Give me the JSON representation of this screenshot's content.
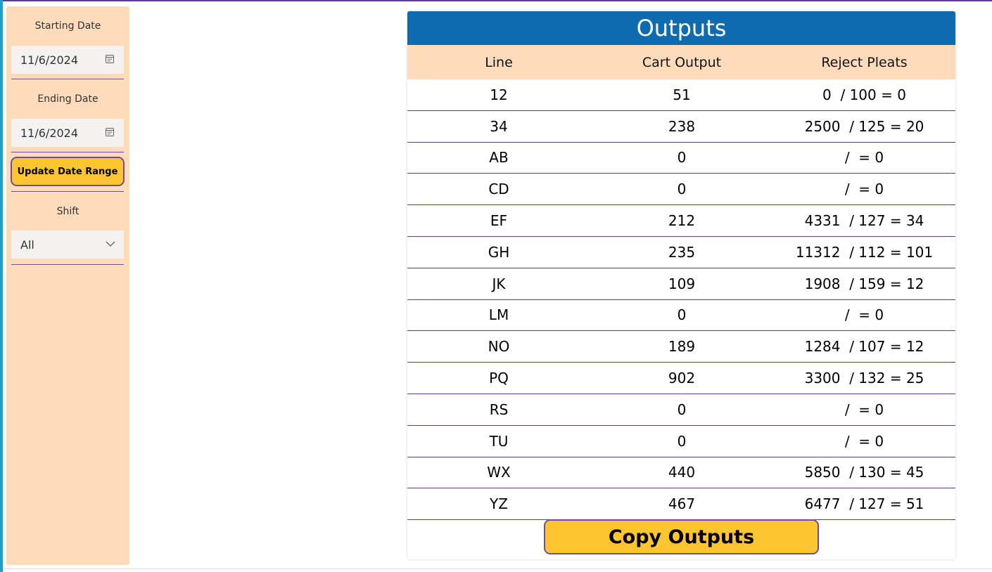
{
  "sidebar": {
    "starting_date_label": "Starting Date",
    "starting_date_value": "11/6/2024",
    "ending_date_label": "Ending Date",
    "ending_date_value": "11/6/2024",
    "update_button_label": "Update Date Range",
    "shift_label": "Shift",
    "shift_value": "All"
  },
  "outputs": {
    "title": "Outputs",
    "columns": [
      "Line",
      "Cart Output",
      "Reject Pleats"
    ],
    "rows": [
      {
        "line": "12",
        "cart_output": "51",
        "reject_pleats": "0  / 100 = 0"
      },
      {
        "line": "34",
        "cart_output": "238",
        "reject_pleats": "2500  / 125 = 20"
      },
      {
        "line": "AB",
        "cart_output": "0",
        "reject_pleats": "/  = 0"
      },
      {
        "line": "CD",
        "cart_output": "0",
        "reject_pleats": "/  = 0"
      },
      {
        "line": "EF",
        "cart_output": "212",
        "reject_pleats": "4331  / 127 = 34"
      },
      {
        "line": "GH",
        "cart_output": "235",
        "reject_pleats": "11312  / 112 = 101"
      },
      {
        "line": "JK",
        "cart_output": "109",
        "reject_pleats": "1908  / 159 = 12"
      },
      {
        "line": "LM",
        "cart_output": "0",
        "reject_pleats": "/  = 0"
      },
      {
        "line": "NO",
        "cart_output": "189",
        "reject_pleats": "1284  / 107 = 12"
      },
      {
        "line": "PQ",
        "cart_output": "902",
        "reject_pleats": "3300  / 132 = 25"
      },
      {
        "line": "RS",
        "cart_output": "0",
        "reject_pleats": "/  = 0"
      },
      {
        "line": "TU",
        "cart_output": "0",
        "reject_pleats": "/  = 0"
      },
      {
        "line": "WX",
        "cart_output": "440",
        "reject_pleats": "5850  / 130 = 45"
      },
      {
        "line": "YZ",
        "cart_output": "467",
        "reject_pleats": "6477  / 127 = 51"
      }
    ],
    "copy_button_label": "Copy Outputs"
  },
  "colors": {
    "header_blue": "#0f6bb0",
    "peach": "#fedbbb",
    "button_yellow": "#fdc532",
    "border_purple": "#6b4f99"
  },
  "icons": {
    "date_picker": "calendar-icon",
    "shift_dropdown": "chevron-down-icon"
  }
}
